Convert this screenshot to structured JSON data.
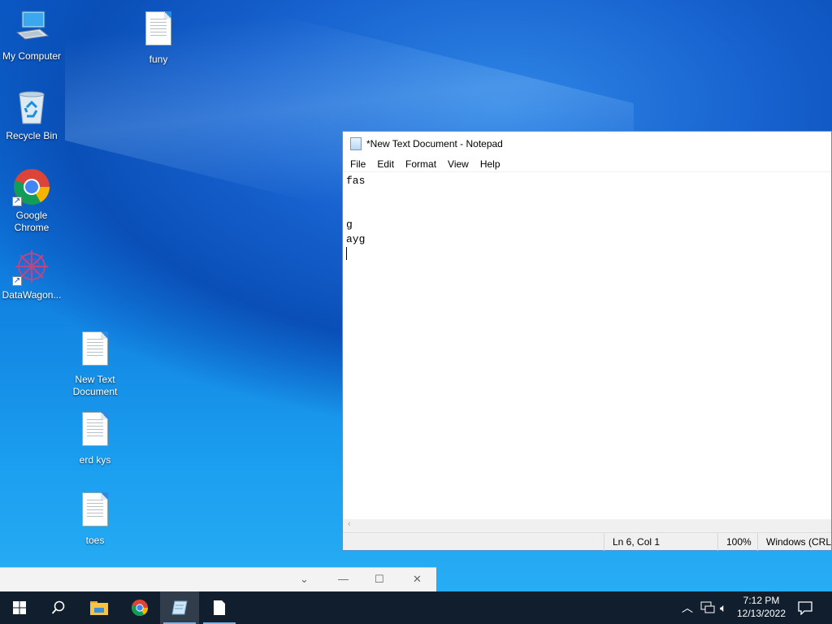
{
  "desktop": {
    "icons": [
      {
        "label": "My Computer",
        "icon": "computer-icon"
      },
      {
        "label": "funy",
        "icon": "text-file-icon"
      },
      {
        "label": "Recycle Bin",
        "icon": "recycle-bin-icon"
      },
      {
        "label": "Google Chrome",
        "icon": "chrome-icon"
      },
      {
        "label": "DataWagon...",
        "icon": "datawagon-icon"
      },
      {
        "label": "New Text Document",
        "icon": "text-file-icon"
      },
      {
        "label": "erd kys",
        "icon": "text-file-icon"
      },
      {
        "label": "toes",
        "icon": "text-file-icon"
      }
    ]
  },
  "notepad": {
    "title": "*New Text Document - Notepad",
    "menu": [
      "File",
      "Edit",
      "Format",
      "View",
      "Help"
    ],
    "lines": [
      "fas",
      "",
      "",
      "g",
      "ayg",
      ""
    ],
    "status": {
      "position": "Ln 6, Col 1",
      "zoom": "100%",
      "line_ending": "Windows (CRLF"
    }
  },
  "background_window": {
    "controls": [
      "chevron-down-icon",
      "minimize-icon",
      "maximize-icon",
      "close-icon"
    ]
  },
  "taskbar": {
    "pinned": [
      "start-icon",
      "search-icon",
      "file-explorer-icon",
      "chrome-icon",
      "notepad-icon",
      "text-file-icon"
    ],
    "clock": {
      "time": "7:12 PM",
      "date": "12/13/2022"
    }
  },
  "colors": {
    "taskbar": "#10182a",
    "accent": "#7fb3e8",
    "notepad_border": "#5a8fcf"
  }
}
